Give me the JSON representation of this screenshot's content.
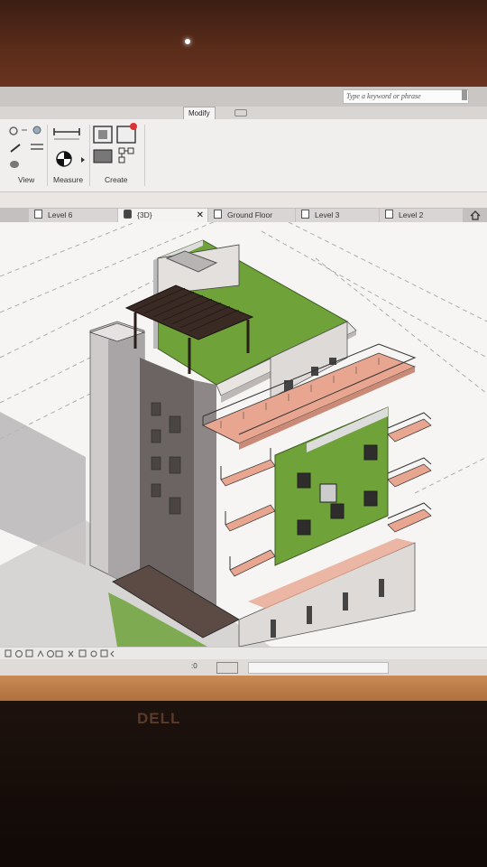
{
  "search": {
    "placeholder": "Type a keyword or phrase"
  },
  "ribbon": {
    "tabs": [
      {
        "label": "Modify",
        "active": true
      }
    ],
    "groups": [
      {
        "label": "View"
      },
      {
        "label": "Measure"
      },
      {
        "label": "Create"
      }
    ]
  },
  "view_tabs": [
    {
      "label": "Level 6",
      "active": false
    },
    {
      "label": "{3D}",
      "active": true,
      "closable": true
    },
    {
      "label": "Ground Floor",
      "active": false
    },
    {
      "label": "Level 3",
      "active": false
    },
    {
      "label": "Level 2",
      "active": false
    }
  ],
  "statusbar": {
    "zero": ":0"
  },
  "bezel": {
    "brand": "DELL"
  },
  "colors": {
    "roof_green": "#6fa33a",
    "terrace": "#e8a690",
    "wall": "#d6d2d0",
    "pergola": "#3a2a24"
  },
  "icons": [
    "light-icon",
    "ruler-icon",
    "align-icon",
    "split-icon",
    "create-icon",
    "home-icon",
    "cube-icon",
    "document-icon"
  ]
}
